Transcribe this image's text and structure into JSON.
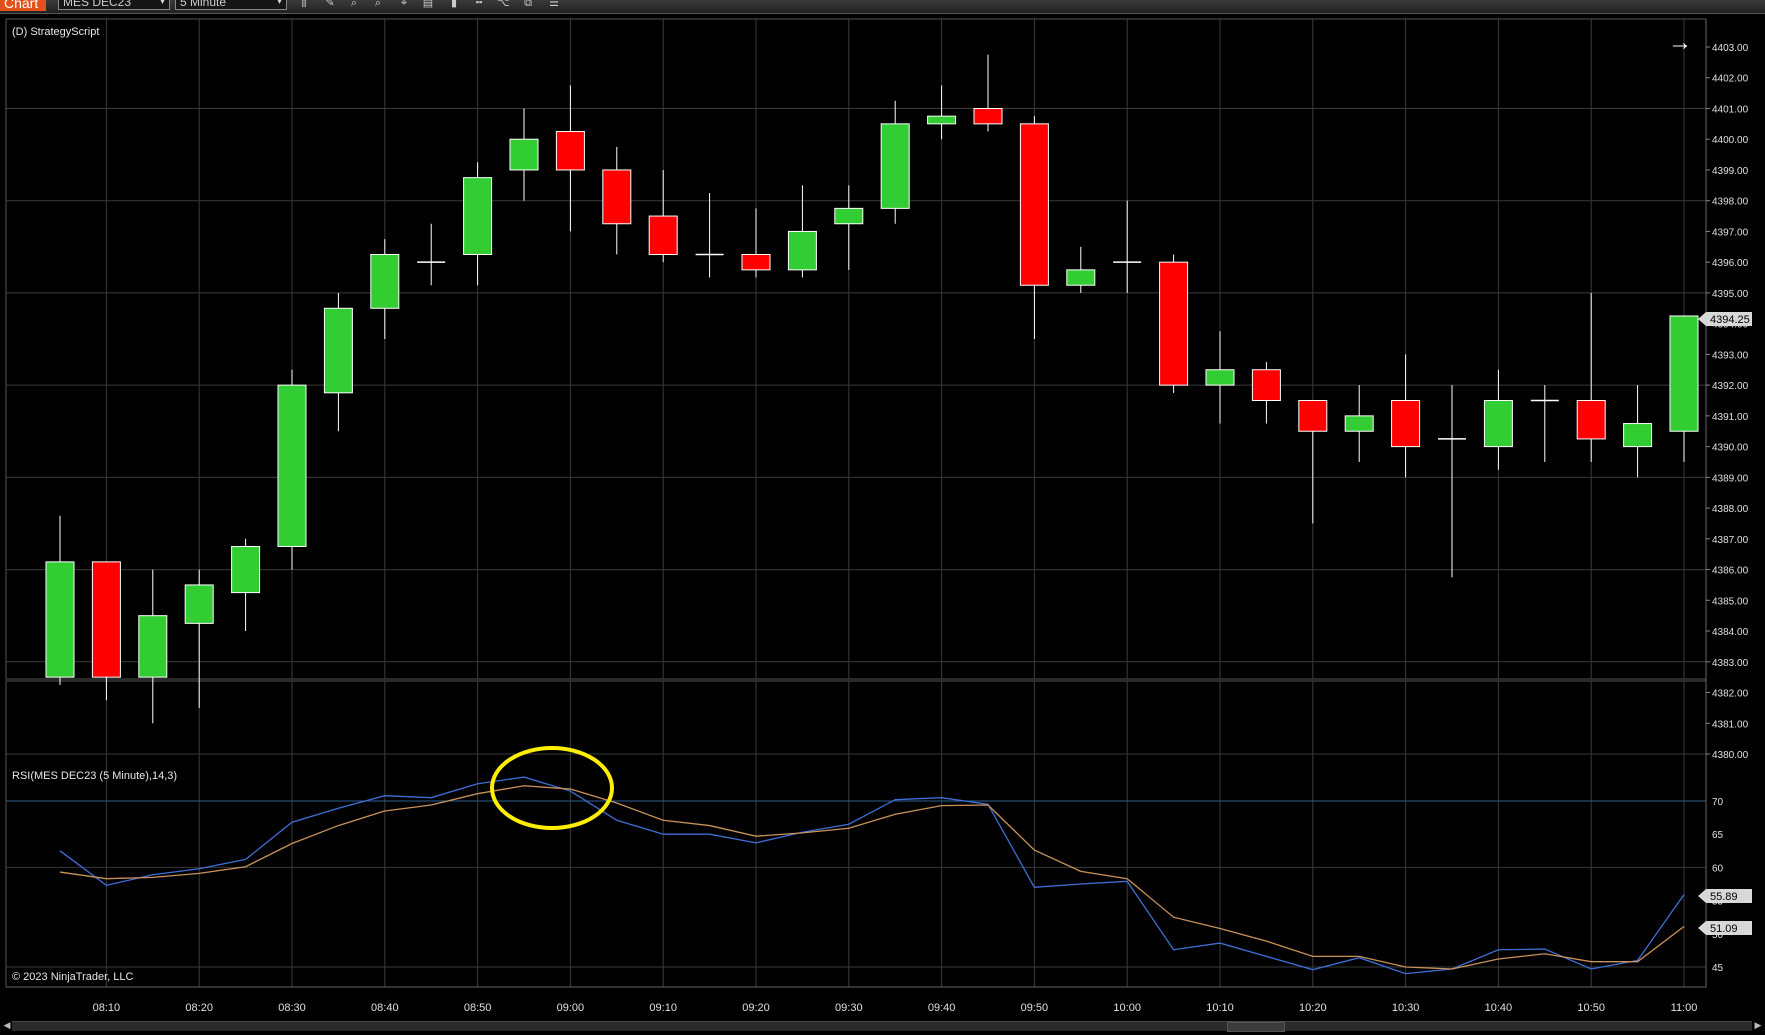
{
  "toolbar": {
    "chart_tab": "Chart",
    "instrument": "MES DEC23",
    "interval": "5 Minute",
    "icons": [
      "bar-type-icon",
      "pencil-icon",
      "zoom-in-icon",
      "zoom-out-icon",
      "crosshair-icon",
      "properties-icon",
      "strategy-icon",
      "indicator-icon",
      "template-icon",
      "data-box-icon"
    ]
  },
  "panels": {
    "price_label": "(D) StrategyScript",
    "rsi_label": "RSI(MES DEC23 (5 Minute),14,3)",
    "copyright": "© 2023 NinjaTrader, LLC",
    "nav_arrow": "→"
  },
  "colors": {
    "up": "#32cd32",
    "down": "#ff0000",
    "rsi_line": "#3e6fd6",
    "avg_line": "#c8935a",
    "highlight": "#ffee00",
    "grid": "#3a3a3a"
  },
  "price_axis": {
    "ticks": [
      "4380.00",
      "4381.00",
      "4382.00",
      "4383.00",
      "4384.00",
      "4385.00",
      "4386.00",
      "4387.00",
      "4388.00",
      "4389.00",
      "4390.00",
      "4391.00",
      "4392.00",
      "4393.00",
      "4394.00",
      "4395.00",
      "4396.00",
      "4397.00",
      "4398.00",
      "4399.00",
      "4400.00",
      "4401.00",
      "4402.00",
      "4403.00"
    ],
    "current_price": "4394.25"
  },
  "rsi_axis": {
    "ticks": [
      "45",
      "50",
      "55",
      "60",
      "65",
      "70"
    ],
    "rsi_value": "55.89",
    "avg_value": "51.09"
  },
  "time_axis": {
    "labels": [
      "08:10",
      "08:20",
      "08:30",
      "08:40",
      "08:50",
      "09:00",
      "09:10",
      "09:20",
      "09:30",
      "09:40",
      "09:50",
      "10:00",
      "10:10",
      "10:20",
      "10:30",
      "10:40",
      "10:50",
      "11:00"
    ]
  },
  "chart_data": [
    {
      "type": "candlestick",
      "instrument": "MES DEC23",
      "x_times": [
        "08:05",
        "08:10",
        "08:15",
        "08:20",
        "08:25",
        "08:30",
        "08:35",
        "08:40",
        "08:45",
        "08:50",
        "08:55",
        "09:00",
        "09:05",
        "09:10",
        "09:15",
        "09:20",
        "09:25",
        "09:30",
        "09:35",
        "09:40",
        "09:45",
        "09:50",
        "09:55",
        "10:00",
        "10:05",
        "10:10",
        "10:15",
        "10:20",
        "10:25",
        "10:30",
        "10:35",
        "10:40",
        "10:45",
        "10:50",
        "10:55",
        "11:00"
      ],
      "open": [
        4382.5,
        4386.25,
        4382.5,
        4384.25,
        4385.25,
        4386.75,
        4391.75,
        4394.5,
        4396.0,
        4396.25,
        4399.0,
        4400.25,
        4399.0,
        4397.5,
        4396.25,
        4396.25,
        4395.75,
        4397.25,
        4397.75,
        4400.5,
        4401.0,
        4400.5,
        4395.25,
        4396.0,
        4396.0,
        4392.0,
        4392.5,
        4391.5,
        4390.5,
        4391.5,
        4390.25,
        4390.0,
        4391.5,
        4391.5,
        4390.0,
        4390.5
      ],
      "high": [
        4387.75,
        4386.25,
        4386.0,
        4386.0,
        4387.0,
        4392.5,
        4395.0,
        4396.75,
        4397.25,
        4399.25,
        4401.0,
        4401.75,
        4399.75,
        4399.0,
        4398.25,
        4397.75,
        4398.5,
        4398.5,
        4401.25,
        4401.75,
        4402.75,
        4400.75,
        4396.5,
        4398.0,
        4396.25,
        4393.75,
        4392.75,
        4391.5,
        4392.0,
        4393.0,
        4392.0,
        4392.5,
        4392.0,
        4395.0,
        4392.0,
        4394.25
      ],
      "low": [
        4382.25,
        4381.75,
        4381.0,
        4381.5,
        4384.0,
        4386.0,
        4390.5,
        4393.5,
        4395.25,
        4395.25,
        4398.0,
        4397.0,
        4396.25,
        4396.0,
        4395.5,
        4395.5,
        4395.5,
        4395.75,
        4397.25,
        4400.0,
        4400.25,
        4393.5,
        4395.0,
        4395.0,
        4391.75,
        4390.75,
        4390.75,
        4387.5,
        4389.5,
        4389.0,
        4385.75,
        4389.25,
        4389.5,
        4389.5,
        4389.0,
        4389.5
      ],
      "close": [
        4386.25,
        4382.5,
        4384.5,
        4385.5,
        4386.75,
        4392.0,
        4394.5,
        4396.25,
        4396.0,
        4398.75,
        4400.0,
        4399.0,
        4397.25,
        4396.25,
        4396.25,
        4395.75,
        4397.0,
        4397.75,
        4400.5,
        4400.75,
        4400.5,
        4395.25,
        4395.75,
        4396.0,
        4392.0,
        4392.5,
        4391.5,
        4390.5,
        4391.0,
        4390.0,
        4390.25,
        4391.5,
        4391.5,
        4390.25,
        4390.75,
        4394.25
      ],
      "ylim": [
        4380,
        4403
      ]
    },
    {
      "type": "line",
      "title": "RSI(MES DEC23 (5 Minute),14,3)",
      "x_times": [
        "08:05",
        "08:10",
        "08:15",
        "08:20",
        "08:25",
        "08:30",
        "08:35",
        "08:40",
        "08:45",
        "08:50",
        "08:55",
        "09:00",
        "09:05",
        "09:10",
        "09:15",
        "09:20",
        "09:25",
        "09:30",
        "09:35",
        "09:40",
        "09:45",
        "09:50",
        "09:55",
        "10:00",
        "10:05",
        "10:10",
        "10:15",
        "10:20",
        "10:25",
        "10:30",
        "10:35",
        "10:40",
        "10:45",
        "10:50",
        "10:55",
        "11:00"
      ],
      "series": [
        {
          "values": [
            62.5,
            57.3,
            58.9,
            59.8,
            61.2,
            66.8,
            68.9,
            70.8,
            70.5,
            72.6,
            73.6,
            71.5,
            67.1,
            65.0,
            65.0,
            63.7,
            65.3,
            66.5,
            70.2,
            70.5,
            69.5,
            57.0,
            57.5,
            57.9,
            47.6,
            48.6,
            46.6,
            44.6,
            46.4,
            44.0,
            44.7,
            47.6,
            47.7,
            44.7,
            46.0,
            55.9
          ]
        },
        {
          "values": [
            59.3,
            58.3,
            58.5,
            59.1,
            60.1,
            63.6,
            66.3,
            68.5,
            69.4,
            71.1,
            72.3,
            71.8,
            69.7,
            67.1,
            66.3,
            64.7,
            65.2,
            65.9,
            68.0,
            69.3,
            69.4,
            62.6,
            59.4,
            58.3,
            52.5,
            50.8,
            48.9,
            46.6,
            46.6,
            45.0,
            44.7,
            46.2,
            47.0,
            45.8,
            45.8,
            51.1
          ]
        }
      ],
      "ylim": [
        42,
        76
      ],
      "reference_line": 70
    }
  ]
}
